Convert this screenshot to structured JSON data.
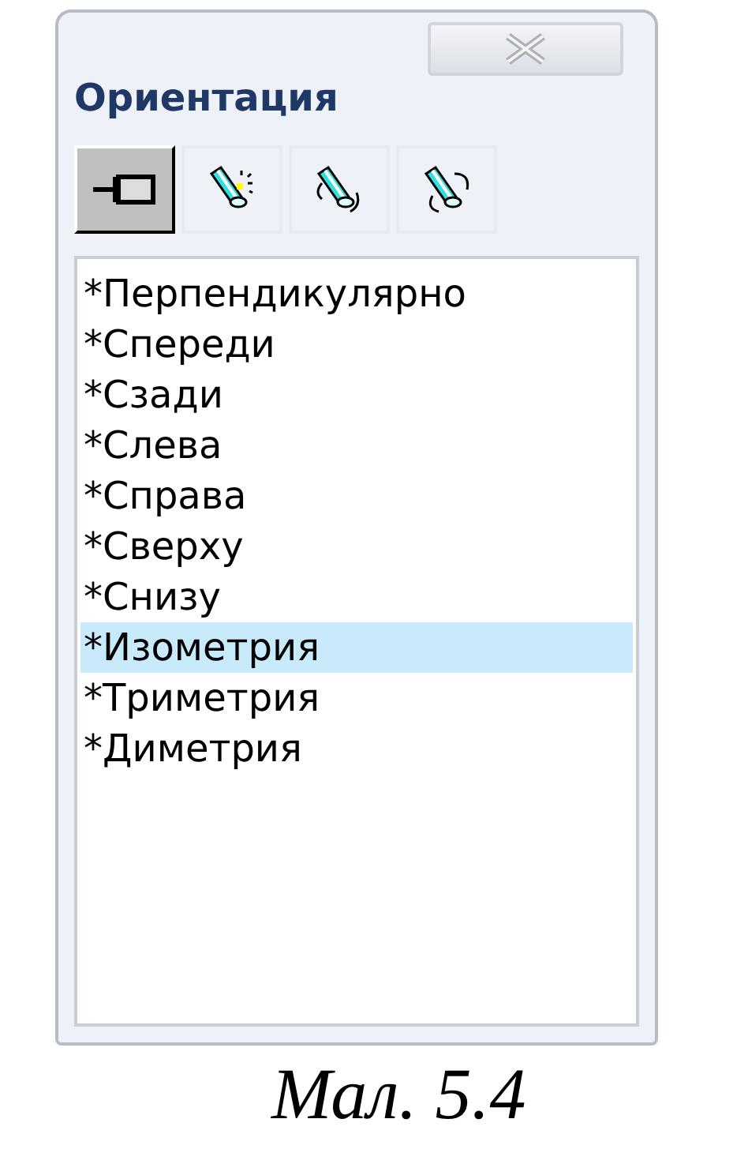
{
  "window": {
    "title": "Ориентация"
  },
  "toolbar": [
    {
      "kind": "pin",
      "selected": true
    },
    {
      "kind": "new-view",
      "selected": false
    },
    {
      "kind": "update-view",
      "selected": false
    },
    {
      "kind": "reset-views",
      "selected": false
    }
  ],
  "views": [
    {
      "label": "*Перпендикулярно",
      "selected": false
    },
    {
      "label": "*Спереди",
      "selected": false
    },
    {
      "label": "*Сзади",
      "selected": false
    },
    {
      "label": "*Слева",
      "selected": false
    },
    {
      "label": "*Справа",
      "selected": false
    },
    {
      "label": "*Сверху",
      "selected": false
    },
    {
      "label": "*Снизу",
      "selected": false
    },
    {
      "label": "*Изометрия",
      "selected": true
    },
    {
      "label": "*Триметрия",
      "selected": false
    },
    {
      "label": "*Диметрия",
      "selected": false
    }
  ],
  "caption": "Мал. 5.4"
}
